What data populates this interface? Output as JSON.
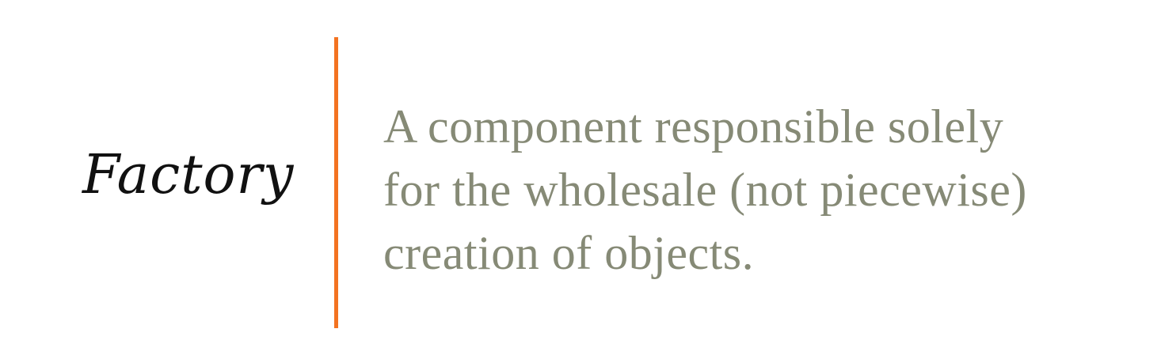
{
  "slide": {
    "term": "Factory",
    "definition_lines": [
      "A component responsible solely",
      "for the wholesale (not piecewise)",
      "creation of objects."
    ],
    "colors": {
      "accent": "#F37321",
      "definition_text": "#868A76",
      "term_text": "#111111"
    }
  }
}
